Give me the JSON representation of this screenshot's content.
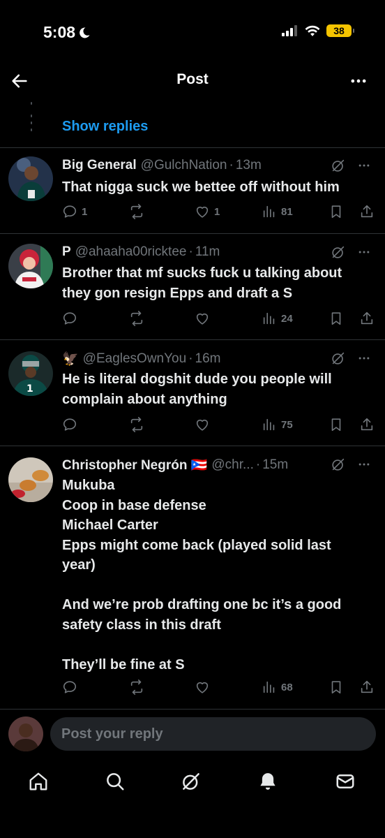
{
  "status_bar": {
    "time": "5:08",
    "battery": "38"
  },
  "header": {
    "title": "Post"
  },
  "show_replies": "Show replies",
  "posts": [
    {
      "name": "Big General",
      "handle": "@GulchNation",
      "time": "13m",
      "lines": [
        "That nigga suck we bettee off without him"
      ],
      "replies": "1",
      "reposts": "",
      "likes": "1",
      "views": "81"
    },
    {
      "name": "P",
      "handle": "@ahaaha00ricktee",
      "time": "11m",
      "lines": [
        "Brother that mf sucks fuck u talking about",
        "they gon resign Epps and draft a S"
      ],
      "replies": "",
      "reposts": "",
      "likes": "",
      "views": "24"
    },
    {
      "name": "🦅",
      "handle": "@EaglesOwnYou",
      "time": "16m",
      "lines": [
        "He is literal dogshit dude you people will",
        "complain about anything"
      ],
      "replies": "",
      "reposts": "",
      "likes": "",
      "views": "75"
    },
    {
      "name": "Christopher Negrón 🇵🇷",
      "handle": "@chr...",
      "time": "15m",
      "lines": [
        "Mukuba",
        "Coop in base defense",
        "Michael Carter",
        "Epps might come back (played solid last",
        "year)",
        "",
        "And we’re prob drafting one bc it’s a good",
        "safety class in this draft",
        "",
        "They’ll be fine at S"
      ],
      "replies": "",
      "reposts": "",
      "likes": "",
      "views": "68"
    }
  ],
  "reply_bar": {
    "placeholder": "Post your reply"
  },
  "tabbar": [
    "home-icon",
    "search-icon",
    "grok-icon",
    "notifications-icon",
    "messages-icon"
  ],
  "colors": {
    "background": "#000000",
    "accent": "#1d9bf0",
    "muted": "#71767b",
    "divider": "#2f3336",
    "battery": "#f5c400"
  }
}
